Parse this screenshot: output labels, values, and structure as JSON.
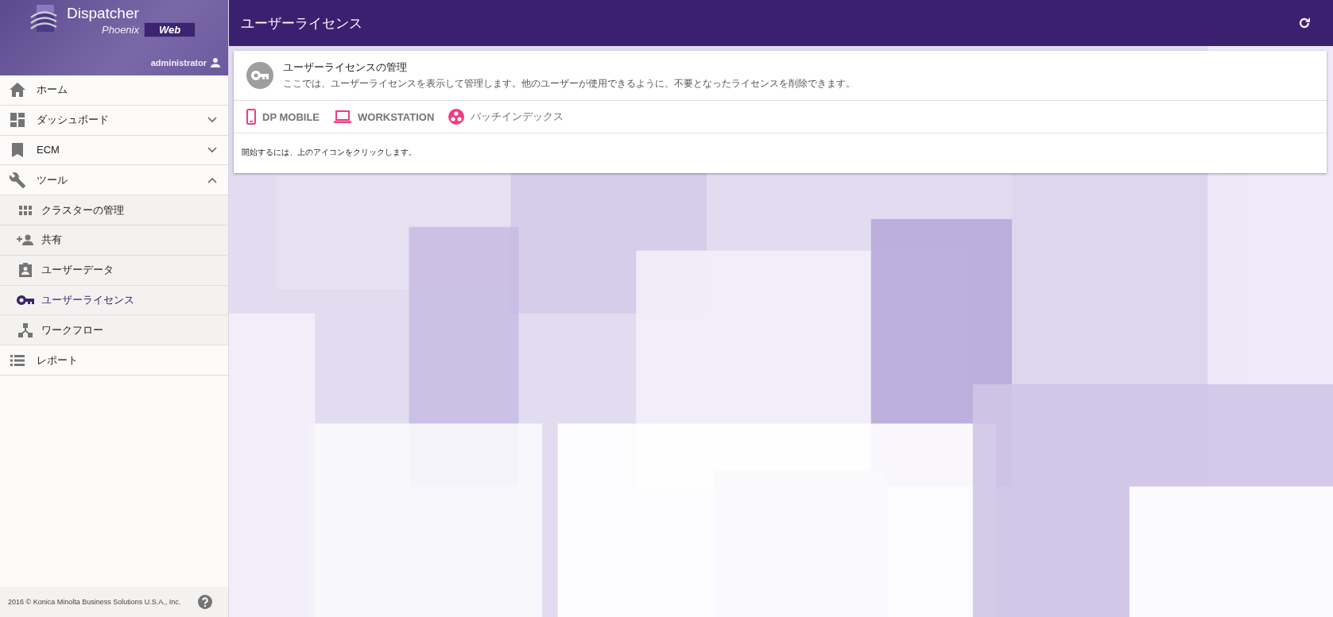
{
  "sidebar": {
    "logo": {
      "title": "Dispatcher",
      "subtitle": "Phoenix",
      "badge": "Web"
    },
    "user": "administrator",
    "items": [
      {
        "kind": "link",
        "label": "ホーム",
        "selected": false
      },
      {
        "kind": "group",
        "label": "ダッシュボード",
        "expanded": false,
        "selected": false
      },
      {
        "kind": "group",
        "label": "ECM",
        "expanded": false,
        "selected": false
      },
      {
        "kind": "group",
        "label": "ツール",
        "expanded": true,
        "selected": false,
        "children": [
          {
            "label": "クラスターの管理",
            "selected": false
          },
          {
            "label": "共有",
            "selected": false
          },
          {
            "label": "ユーザーデータ",
            "selected": false
          },
          {
            "label": "ユーザーライセンス",
            "selected": true
          },
          {
            "label": "ワークフロー",
            "selected": false
          }
        ]
      },
      {
        "kind": "link",
        "label": "レポート",
        "selected": false
      }
    ],
    "footer": "2016 © Konica Minolta Business Solutions U.S.A., Inc."
  },
  "top_bar": {
    "title": "ユーザーライセンス"
  },
  "card": {
    "title": "ユーザーライセンスの管理",
    "description": "ここでは、ユーザーライセンスを表示して管理します。他のユーザーが使用できるように、不要となったライセンスを削除できます。",
    "tabs": [
      {
        "label": "DP MOBILE"
      },
      {
        "label": "WORKSTATION"
      },
      {
        "label": "バッチインデックス"
      }
    ],
    "hint": "開始するには、上のアイコンをクリックします。"
  }
}
